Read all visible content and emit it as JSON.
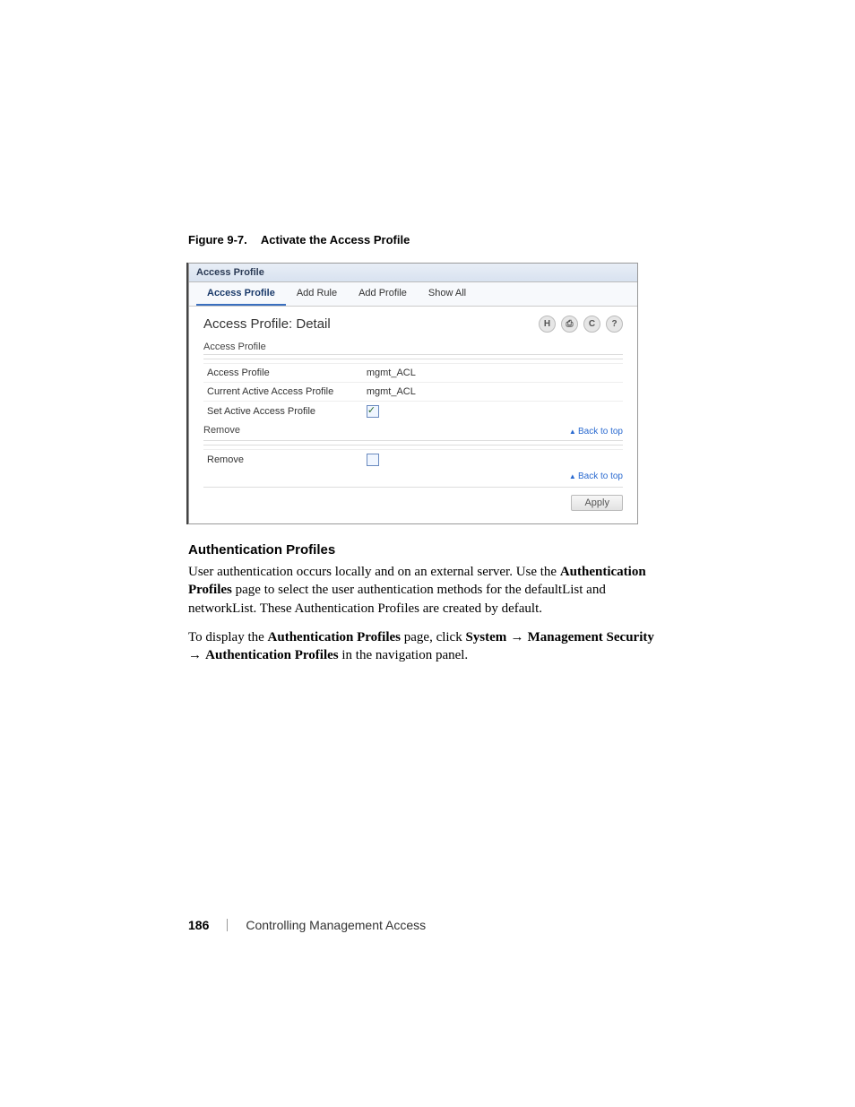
{
  "figure": {
    "number": "Figure 9-7.",
    "title": "Activate the Access Profile"
  },
  "screenshot": {
    "window_title": "Access Profile",
    "tabs": {
      "t0": "Access Profile",
      "t1": "Add Rule",
      "t2": "Add Profile",
      "t3": "Show All"
    },
    "page_title": "Access Profile: Detail",
    "section1_label": "Access Profile",
    "row_access_profile": {
      "label": "Access Profile",
      "value": "mgmt_ACL"
    },
    "row_current_active": {
      "label": "Current Active Access Profile",
      "value": "mgmt_ACL"
    },
    "row_set_active": {
      "label": "Set Active Access Profile"
    },
    "section2_label": "Remove",
    "row_remove": {
      "label": "Remove"
    },
    "back_to_top": "Back to top",
    "apply": "Apply"
  },
  "section": {
    "heading": "Authentication Profiles",
    "para1_a": "User authentication occurs locally and on an external server. Use the ",
    "para1_bold": "Authentication Profiles",
    "para1_b": " page to select the user authentication methods for the defaultList and networkList. These Authentication Profiles are created by default.",
    "para2_a": "To display the ",
    "para2_bold1": "Authentication Profiles",
    "para2_b": " page, click ",
    "para2_bold2": "System",
    "para2_arrow": " → ",
    "para2_bold3": "Management Security",
    "para2_arrow2": " → ",
    "para2_bold4": "Authentication Profiles",
    "para2_c": " in the navigation panel."
  },
  "footer": {
    "page_number": "186",
    "chapter": "Controlling Management Access"
  }
}
